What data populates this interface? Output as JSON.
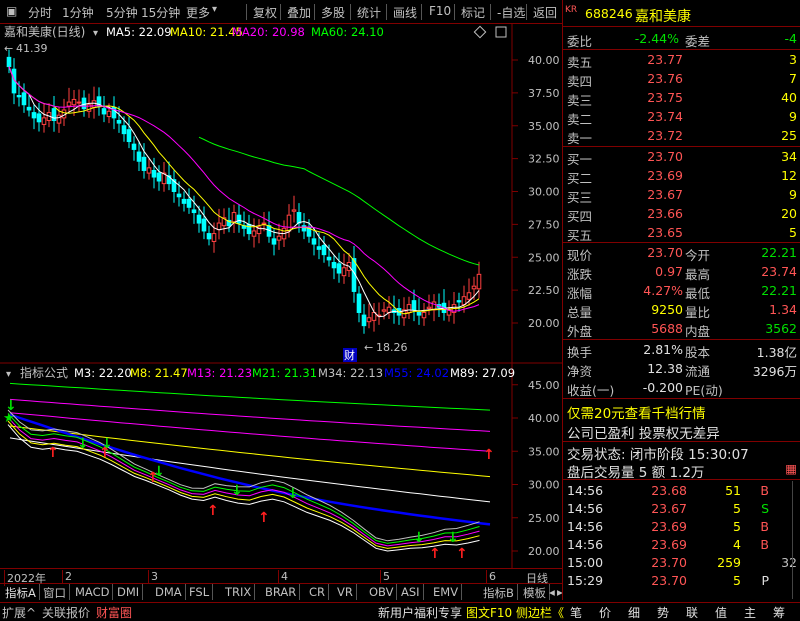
{
  "toolbar": {
    "items": [
      "分时",
      "1分钟",
      "5分钟",
      "15分钟",
      "更多",
      "复权",
      "叠加",
      "多股",
      "统计",
      "画线",
      "F10",
      "标记",
      "-自选",
      "返回"
    ],
    "more_caret": "▾"
  },
  "main_chart": {
    "title": "嘉和美康(日线)",
    "ma": [
      {
        "label": "MA5: 22.09",
        "color": "#ffffff"
      },
      {
        "label": "MA10: 21.45",
        "color": "#ffff00"
      },
      {
        "label": "MA20: 20.98",
        "color": "#ff00ff"
      },
      {
        "label": "MA60: 24.10",
        "color": "#00ff00"
      }
    ],
    "y_labels": [
      "40.00",
      "37.50",
      "35.00",
      "32.50",
      "30.00",
      "27.50",
      "25.00",
      "22.50",
      "20.00"
    ],
    "high_note": "41.39",
    "low_note": "18.26",
    "cai_badge": "财"
  },
  "indicator": {
    "title": "指标公式",
    "lines": [
      {
        "label": "M3: 22.20",
        "color": "#ffffff"
      },
      {
        "label": "M8: 21.47",
        "color": "#ffff00"
      },
      {
        "label": "M13: 21.23",
        "color": "#ff00ff"
      },
      {
        "label": "M21: 21.31",
        "color": "#00ff00"
      },
      {
        "label": "M34: 22.13",
        "color": "#c0c0c0"
      },
      {
        "label": "M55: 24.02",
        "color": "#0000ff"
      },
      {
        "label": "M89: 27.09",
        "color": "#ffffff"
      }
    ],
    "y_labels": [
      "45.00",
      "40.00",
      "35.00",
      "30.00",
      "25.00",
      "20.00"
    ]
  },
  "axis": {
    "date_labels": [
      "2022年",
      "2",
      "3",
      "4",
      "5",
      "6"
    ],
    "period": "日线"
  },
  "tabs1": [
    "指标A",
    "窗口",
    "MACD",
    "DMI",
    "DMA",
    "FSL",
    "TRIX",
    "BRAR",
    "CR",
    "VR",
    "OBV",
    "ASI",
    "EMV",
    "指标B",
    "模板"
  ],
  "tabs2": [
    "扩展^",
    "关联报价",
    "财富圈"
  ],
  "status": {
    "promo": "新用户福利专享",
    "f10": "图文F10",
    "side": "侧边栏《",
    "panel_tabs": [
      "笔",
      "价",
      "细",
      "势",
      "联",
      "值",
      "主",
      "筹"
    ]
  },
  "quote": {
    "kr": "KR",
    "code": "688246",
    "name": "嘉和美康",
    "weibi_label": "委比",
    "weibi_val": "-2.44%",
    "weicha_label": "委差",
    "weicha_val": "-4",
    "asks": [
      {
        "label": "卖五",
        "price": "23.77",
        "vol": "3"
      },
      {
        "label": "卖四",
        "price": "23.76",
        "vol": "7"
      },
      {
        "label": "卖三",
        "price": "23.75",
        "vol": "40"
      },
      {
        "label": "卖二",
        "price": "23.74",
        "vol": "9"
      },
      {
        "label": "卖一",
        "price": "23.72",
        "vol": "25"
      }
    ],
    "bids": [
      {
        "label": "买一",
        "price": "23.70",
        "vol": "34"
      },
      {
        "label": "买二",
        "price": "23.69",
        "vol": "12"
      },
      {
        "label": "买三",
        "price": "23.67",
        "vol": "9"
      },
      {
        "label": "买四",
        "price": "23.66",
        "vol": "20"
      },
      {
        "label": "买五",
        "price": "23.65",
        "vol": "5"
      }
    ],
    "stats": [
      {
        "l1": "现价",
        "v1": "23.70",
        "l2": "今开",
        "v2": "22.21",
        "c1": "red",
        "c2": "green"
      },
      {
        "l1": "涨跌",
        "v1": "0.97",
        "l2": "最高",
        "v2": "23.74",
        "c1": "red",
        "c2": "red"
      },
      {
        "l1": "涨幅",
        "v1": "4.27%",
        "l2": "最低",
        "v2": "22.21",
        "c1": "red",
        "c2": "green"
      },
      {
        "l1": "总量",
        "v1": "9250",
        "l2": "量比",
        "v2": "1.34",
        "c1": "yellow",
        "c2": "red"
      },
      {
        "l1": "外盘",
        "v1": "5688",
        "l2": "内盘",
        "v2": "3562",
        "c1": "red",
        "c2": "green"
      }
    ],
    "stats2": [
      {
        "l1": "换手",
        "v1": "2.81%",
        "l2": "股本",
        "v2": "1.38亿"
      },
      {
        "l1": "净资",
        "v1": "12.38",
        "l2": "流通",
        "v2": "3296万"
      },
      {
        "l1": "收益(一)",
        "v1": "-0.200",
        "l2": "PE(动)",
        "v2": ""
      }
    ],
    "promo1": "仅需20元查看千档行情",
    "promo2": "公司已盈利 投票权无差异",
    "state": "交易状态: 闭市阶段 15:30:07",
    "after": "盘后交易量 5 额 1.2万",
    "ticks": [
      {
        "t": "14:56",
        "p": "23.68",
        "v": "51",
        "s": "B",
        "vc": "yellow",
        "sc": "red"
      },
      {
        "t": "14:56",
        "p": "23.67",
        "v": "5",
        "s": "S",
        "vc": "yellow",
        "sc": "green"
      },
      {
        "t": "14:56",
        "p": "23.69",
        "v": "5",
        "s": "B",
        "vc": "yellow",
        "sc": "red"
      },
      {
        "t": "14:56",
        "p": "23.69",
        "v": "4",
        "s": "B",
        "vc": "yellow",
        "sc": "red"
      },
      {
        "t": "15:00",
        "p": "23.70",
        "v": "259",
        "s": "32",
        "vc": "yellow",
        "sc": "gray"
      },
      {
        "t": "15:29",
        "p": "23.70",
        "v": "5",
        "s": "P",
        "vc": "yellow",
        "sc": "white"
      }
    ]
  }
}
